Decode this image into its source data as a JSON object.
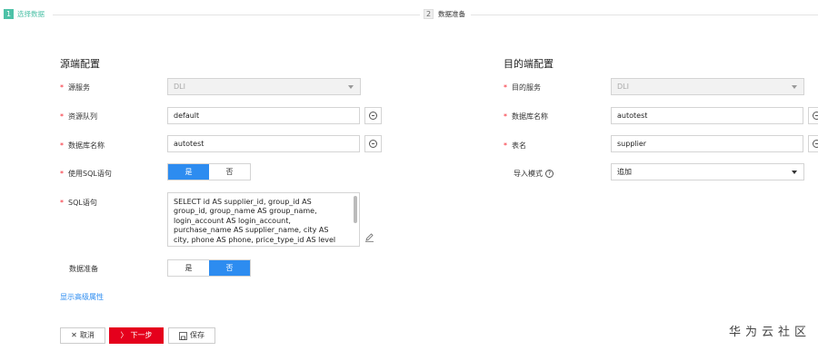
{
  "steps": [
    {
      "number": "1",
      "label": "选择数据"
    },
    {
      "number": "2",
      "label": "数据准备"
    }
  ],
  "source": {
    "title": "源端配置",
    "service": {
      "label": "源服务",
      "value": "DLI"
    },
    "queue": {
      "label": "资源队列",
      "value": "default"
    },
    "database": {
      "label": "数据库名称",
      "value": "autotest"
    },
    "use_sql": {
      "label": "使用SQL语句",
      "options": [
        "是",
        "否"
      ],
      "selected": "是"
    },
    "sql": {
      "label": "SQL语句",
      "value": "SELECT id AS supplier_id,  group_id AS group_id,  group_name AS group_name, login_account AS login_account, purchase_name AS supplier_name,  city AS city, phone AS phone,  price_type_id AS level"
    },
    "prepare": {
      "label": "数据准备",
      "options": [
        "是",
        "否"
      ],
      "selected": "否"
    },
    "advanced_link": "显示高级属性"
  },
  "target": {
    "title": "目的端配置",
    "service": {
      "label": "目的服务",
      "value": "DLI"
    },
    "database": {
      "label": "数据库名称",
      "value": "autotest"
    },
    "table": {
      "label": "表名",
      "value": "supplier"
    },
    "import_mode": {
      "label": "导入模式",
      "value": "追加"
    }
  },
  "actions": {
    "cancel": "取消",
    "next": "下一步",
    "save": "保存"
  },
  "watermark": "华为云社区",
  "colors": {
    "accent": "#4dc1a7",
    "primary": "#2d8cf0",
    "danger": "#e5001c",
    "required": "#f5222d"
  }
}
